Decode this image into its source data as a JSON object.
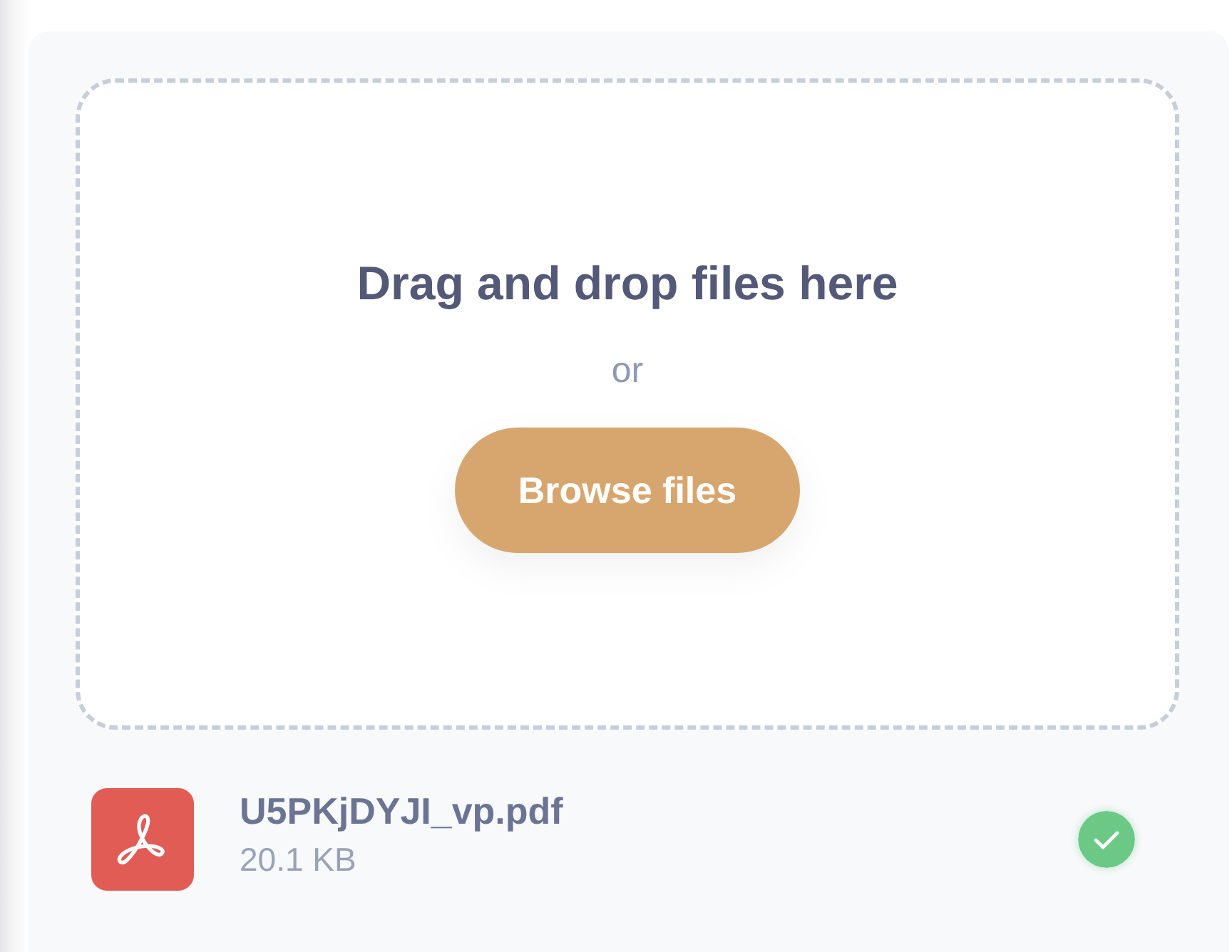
{
  "dropzone": {
    "title": "Drag and drop files here",
    "separator": "or",
    "button": "Browse files"
  },
  "files": [
    {
      "name": "U5PKjDYJI_vp.pdf",
      "size": "20.1 KB",
      "kind": "pdf",
      "uploaded": true
    }
  ]
}
